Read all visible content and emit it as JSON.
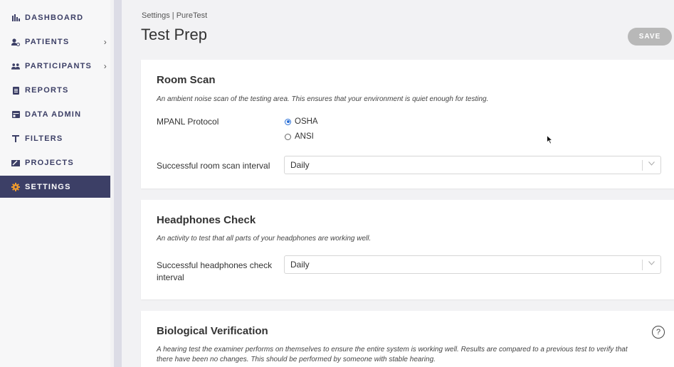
{
  "sidebar": {
    "items": [
      {
        "label": "DASHBOARD",
        "icon": "bar-chart-icon"
      },
      {
        "label": "PATIENTS",
        "icon": "patients-icon"
      },
      {
        "label": "PARTICIPANTS",
        "icon": "participants-icon"
      },
      {
        "label": "REPORTS",
        "icon": "report-icon"
      },
      {
        "label": "DATA ADMIN",
        "icon": "data-admin-icon"
      },
      {
        "label": "FILTERS",
        "icon": "filter-icon"
      },
      {
        "label": "PROJECTS",
        "icon": "projects-icon"
      },
      {
        "label": "SETTINGS",
        "icon": "gear-icon",
        "active": true
      }
    ],
    "chevron": "›"
  },
  "header": {
    "breadcrumb": "Settings | PureTest",
    "title": "Test Prep",
    "save_label": "SAVE"
  },
  "room_scan": {
    "title": "Room Scan",
    "description": "An ambient noise scan of the testing area. This ensures that your environment is quiet enough for testing.",
    "protocol_label": "MPANL Protocol",
    "protocol_options": [
      {
        "label": "OSHA",
        "selected": true
      },
      {
        "label": "ANSI",
        "selected": false
      }
    ],
    "interval_label": "Successful room scan interval",
    "interval_value": "Daily"
  },
  "headphones_check": {
    "title": "Headphones Check",
    "description": "An activity to test that all parts of your headphones are working well.",
    "interval_label_line1": "Successful headphones check",
    "interval_label_line2": "interval",
    "interval_value": "Daily"
  },
  "biological_verification": {
    "title": "Biological Verification",
    "help": "?",
    "description_line1": "A hearing test the examiner performs on themselves to ensure the entire system is working well. Results are compared to a previous test to verify that",
    "description_line2": "there have been no changes. This should be performed by someone with stable hearing."
  },
  "colors": {
    "sidebar_active_bg": "#3c3f66",
    "accent_orange": "#f39c2c",
    "save_disabled": "#b8b8b8",
    "radio_selected": "#2a6fd6"
  }
}
